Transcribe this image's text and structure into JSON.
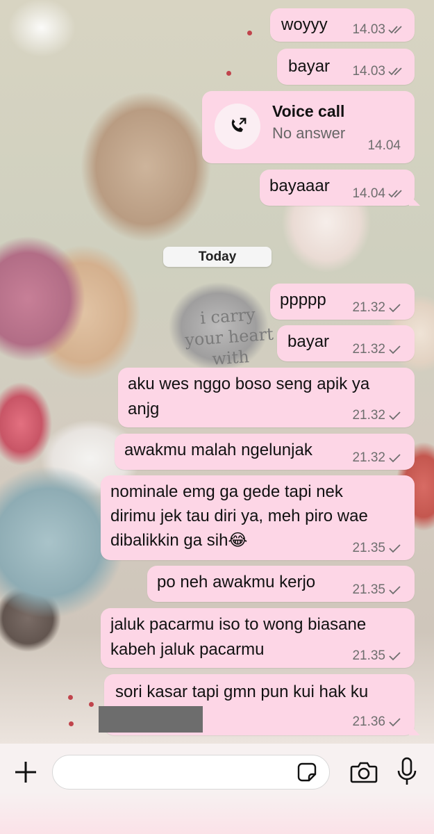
{
  "chat": {
    "messages": [
      {
        "text": "woyyy",
        "time": "14.03",
        "status": "read"
      },
      {
        "text": "bayar",
        "time": "14.03",
        "status": "read"
      },
      {
        "text": "bayaaar",
        "time": "14.04",
        "status": "read"
      },
      {
        "text": "ppppp",
        "time": "21.32",
        "status": "sent"
      },
      {
        "text": "bayar",
        "time": "21.32",
        "status": "sent"
      },
      {
        "line1": "aku wes nggo boso seng apik ya",
        "line2": "anjg",
        "time": "21.32",
        "status": "sent"
      },
      {
        "text": "awakmu malah ngelunjak",
        "time": "21.32",
        "status": "sent"
      },
      {
        "line1": "nominale emg ga gede tapi nek",
        "line2": "dirimu jek tau diri ya, meh piro wae",
        "line3": "dibalikkin ga sih😂",
        "time": "21.35",
        "status": "sent"
      },
      {
        "text": "po neh awakmu kerjo",
        "time": "21.35",
        "status": "sent"
      },
      {
        "line1": "jaluk pacarmu iso to wong biasane",
        "line2": "kabeh jaluk pacarmu",
        "time": "21.35",
        "status": "sent"
      },
      {
        "line1": "sori kasar tapi gmn pun kui hak ku",
        "time": "21.36",
        "status": "sent"
      }
    ],
    "voice_call": {
      "title": "Voice call",
      "subtitle": "No answer",
      "time": "14.04",
      "icon": "outgoing-call-icon"
    },
    "date_separator": "Today"
  },
  "wallpaper": {
    "sticker_text": [
      "i carry",
      "your heart",
      "with"
    ]
  },
  "input_bar": {
    "placeholder": "",
    "value": "",
    "icons": [
      "plus-icon",
      "sticker-icon",
      "camera-icon",
      "microphone-icon"
    ]
  },
  "colors": {
    "bubble": "#fdd6e6",
    "meta_text": "#6e6e6e",
    "date_pill": "#f5f5f5",
    "input_bar_bg": "#f7f1f1"
  }
}
